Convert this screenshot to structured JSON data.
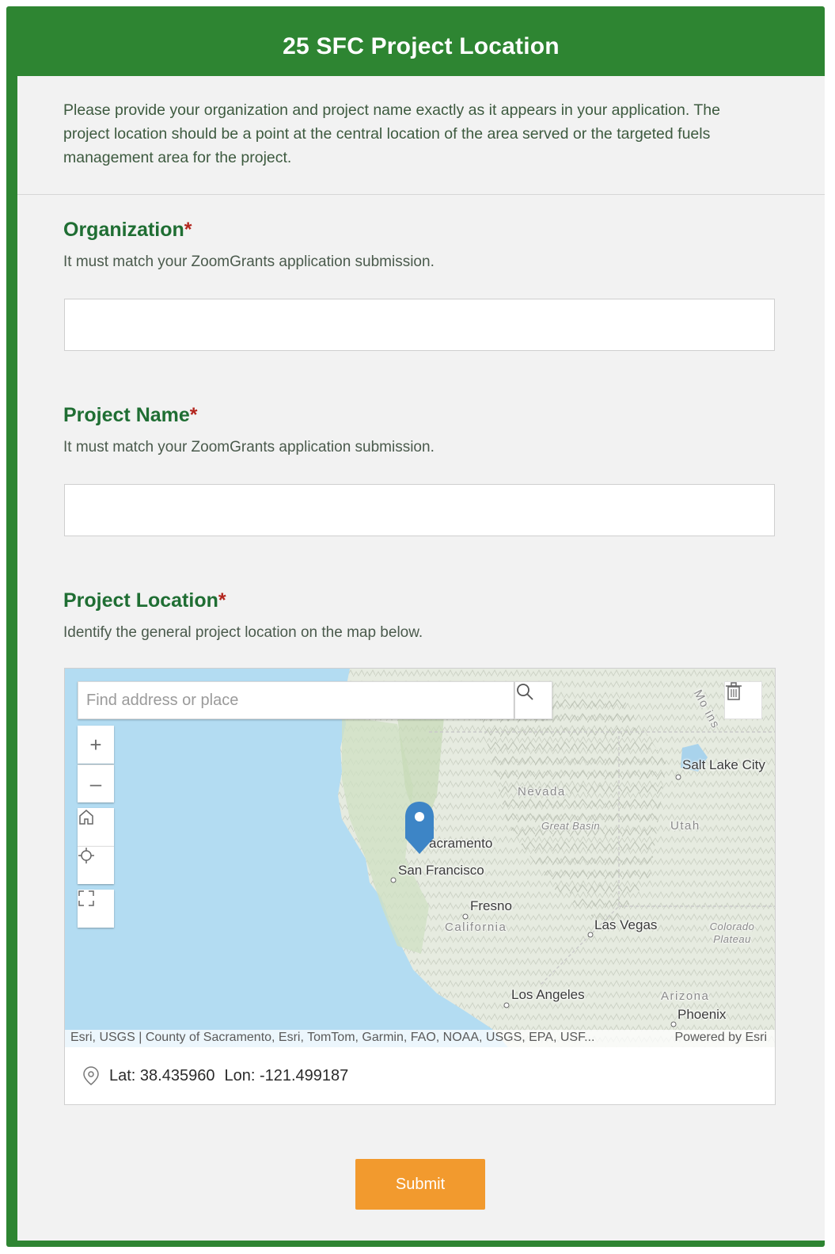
{
  "form": {
    "title": "25 SFC Project Location",
    "intro": "Please provide your organization and project name exactly as it appears in your application. The project location should be a point at the central location of the area served or the targeted fuels management area for the project.",
    "required_marker": "*",
    "questions": [
      {
        "title": "Organization",
        "description": "It must match your ZoomGrants application submission.",
        "value": ""
      },
      {
        "title": "Project Name",
        "description": "It must match your ZoomGrants application submission.",
        "value": ""
      },
      {
        "title": "Project Location",
        "description": "Identify the general project location on the map below."
      }
    ],
    "submit_label": "Submit"
  },
  "map": {
    "search_placeholder": "Find address or place",
    "zoom_in": "+",
    "zoom_out": "–",
    "labels": {
      "salt_lake_city": "Salt Lake City",
      "nevada": "Nevada",
      "great_basin": "Great Basin",
      "utah": "Utah",
      "sacramento": "acramento",
      "san_francisco": "San Francisco",
      "fresno": "Fresno",
      "california": "California",
      "las_vegas": "Las Vegas",
      "colorado_plateau": "Colorado Plateau",
      "los_angeles": "Los Angeles",
      "arizona": "Arizona",
      "phoenix": "Phoenix",
      "mountains_fragment": "Mo  ins"
    },
    "attribution": "Esri, USGS | County of Sacramento, Esri, TomTom, Garmin, FAO, NOAA, USGS, EPA, USF...",
    "powered_by": "Powered by Esri",
    "lat_label": "Lat:",
    "lat": "38.435960",
    "lon_label": "Lon:",
    "lon": "-121.499187",
    "colors": {
      "water": "#b3dcf2",
      "land": "#e9eee3",
      "marker": "#3d85c6"
    },
    "icons": [
      "search-icon",
      "trash-icon",
      "home-icon",
      "locate-icon",
      "fullscreen-icon",
      "location-pin-icon",
      "map-marker-icon"
    ]
  },
  "colors": {
    "header": "#2e8532",
    "heading_text": "#1f6e33",
    "required": "#b3261e",
    "submit": "#f29a2e"
  }
}
